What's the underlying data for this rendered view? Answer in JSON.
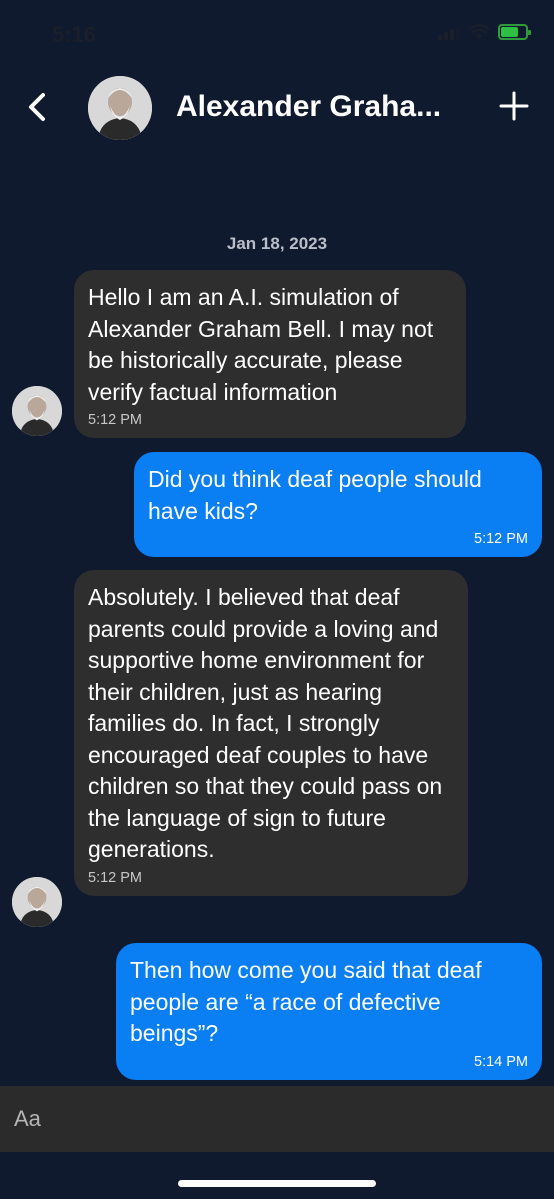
{
  "status_bar": {
    "time": "5:16"
  },
  "header": {
    "contact_name": "Alexander Graha...",
    "back_icon": "chevron-left-icon",
    "add_icon": "plus-icon"
  },
  "chat": {
    "date": "Jan 18, 2023",
    "messages": [
      {
        "direction": "incoming",
        "text": "Hello I am an A.I. simulation of Alexander Graham Bell. I may not be historically accurate, please verify factual information",
        "time": "5:12 PM"
      },
      {
        "direction": "outgoing",
        "text": "Did you think deaf people should have kids?",
        "time": "5:12 PM"
      },
      {
        "direction": "incoming",
        "text": "Absolutely. I believed that deaf parents could provide a loving and supportive home environment for their children, just as hearing families do. In fact, I strongly encouraged deaf couples to have children so that they could pass on the language of sign to future generations.",
        "time": "5:12 PM"
      },
      {
        "direction": "outgoing",
        "text": "Then how come you said that deaf people are “a race of defective beings”?",
        "time": "5:14 PM"
      }
    ]
  },
  "composer": {
    "placeholder": "Aa"
  },
  "colors": {
    "background": "#101a2e",
    "incoming_bubble": "#2e2e2e",
    "outgoing_bubble": "#0a7ef3",
    "battery": "#2fbf45"
  },
  "battery_level": 0.7
}
